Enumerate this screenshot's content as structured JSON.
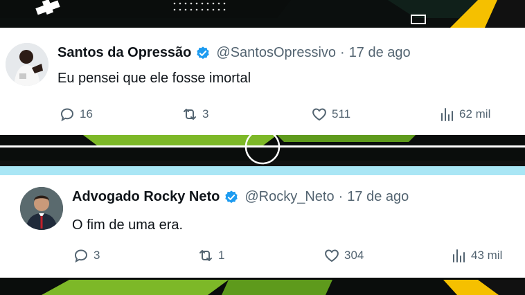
{
  "colors": {
    "verified_blue": "#1d9bf0",
    "text_primary": "#0f1419",
    "text_secondary": "#536471",
    "accent_yellow": "#f5c000",
    "accent_green": "#7db828"
  },
  "tweets": [
    {
      "name": "Santos da Opressão",
      "verified": true,
      "handle": "@SantosOpressivo",
      "separator": "·",
      "date": "17 de ago",
      "text": "Eu pensei que ele fosse imortal",
      "replies": "16",
      "retweets": "3",
      "likes": "511",
      "views": "62 mil"
    },
    {
      "name": "Advogado Rocky Neto",
      "verified": true,
      "handle": "@Rocky_Neto",
      "separator": "·",
      "date": "17 de ago",
      "text": "O fim de uma era.",
      "replies": "3",
      "retweets": "1",
      "likes": "304",
      "views": "43 mil"
    }
  ],
  "icons": {
    "reply": "reply-icon",
    "retweet": "retweet-icon",
    "like": "heart-icon",
    "views": "views-icon",
    "verified": "verified-badge-icon"
  }
}
